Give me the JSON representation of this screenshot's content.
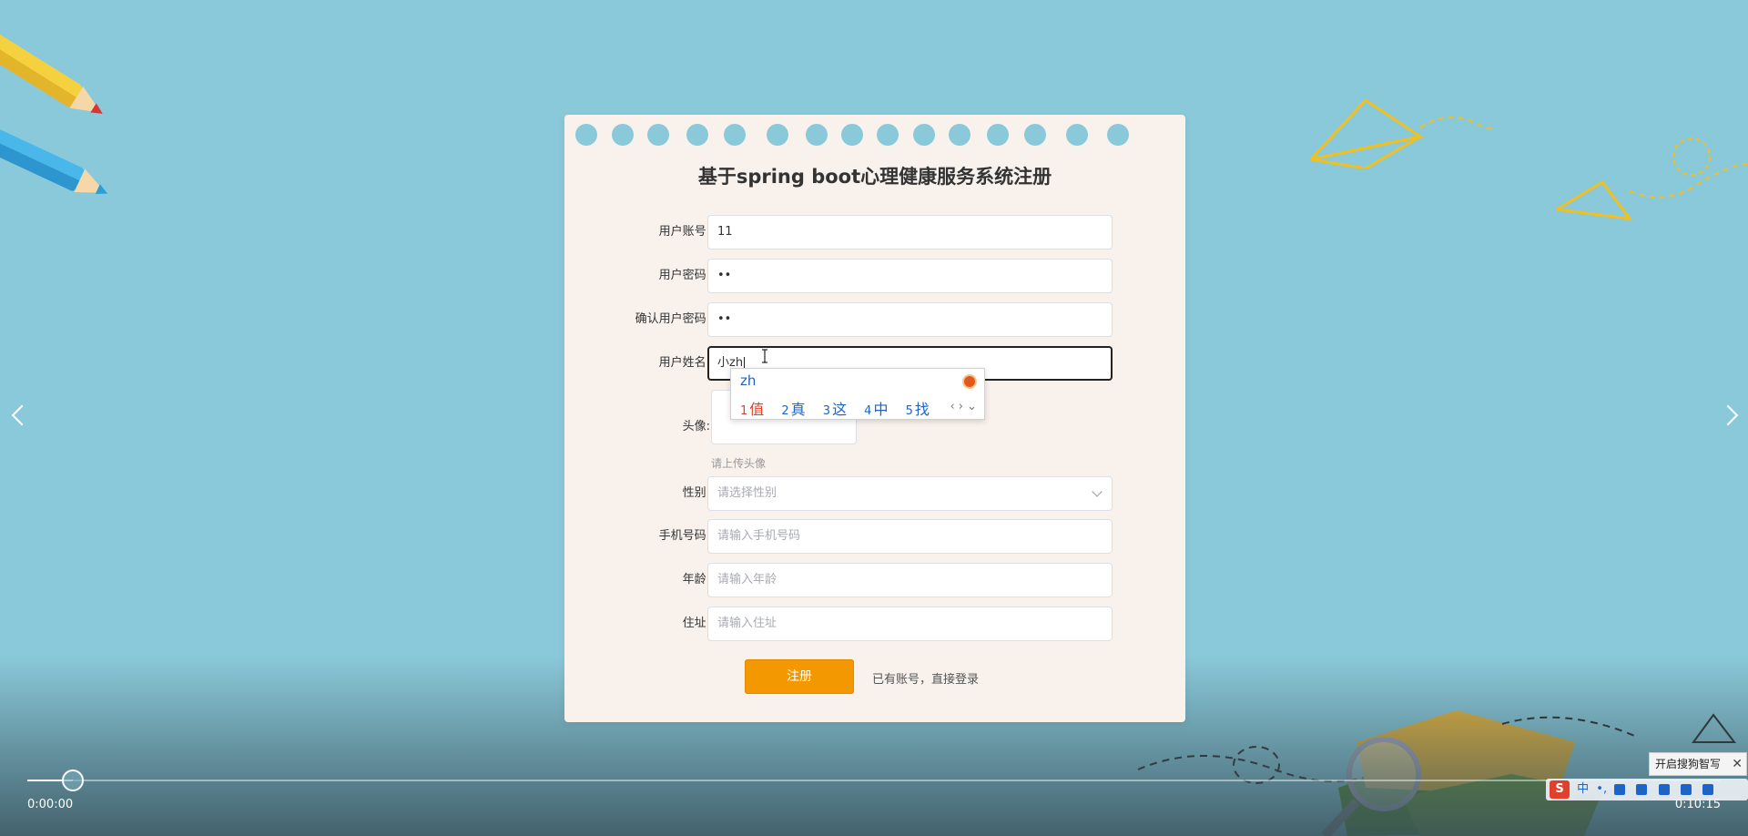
{
  "form": {
    "title": "基于spring boot心理健康服务系统注册",
    "fields": [
      {
        "label": "用户账号:",
        "value": "11",
        "placeholder": ""
      },
      {
        "label": "用户密码:",
        "value": "••",
        "placeholder": ""
      },
      {
        "label": "确认用户密码:",
        "value": "••",
        "placeholder": ""
      },
      {
        "label": "用户姓名:",
        "value": "小zh",
        "placeholder": ""
      }
    ],
    "avatar": {
      "label": "头像:",
      "hint": "请上传头像"
    },
    "gender": {
      "label": "性别:",
      "placeholder": "请选择性别"
    },
    "phone": {
      "label": "手机号码:",
      "placeholder": "请输入手机号码"
    },
    "age": {
      "label": "年龄:",
      "placeholder": "请输入年龄"
    },
    "address": {
      "label": "住址:",
      "placeholder": "请输入住址"
    },
    "register_label": "注册",
    "login_link": "已有账号，直接登录"
  },
  "ime": {
    "composition": "zh",
    "candidates": [
      {
        "num": "1",
        "text": "值"
      },
      {
        "num": "2",
        "text": "真"
      },
      {
        "num": "3",
        "text": "这"
      },
      {
        "num": "4",
        "text": "中"
      },
      {
        "num": "5",
        "text": "找"
      }
    ],
    "nav": "‹ › ⌄"
  },
  "player": {
    "current_time": "0:00:00",
    "total_time": "0:10:15",
    "progress": 0.027
  },
  "sogou": {
    "tooltip": "开启搜狗智写",
    "close": "✕",
    "logo": "S",
    "mode": "中",
    "punct": "•,"
  },
  "colors": {
    "background": "#8ac9d9",
    "card": "#f8f1ec",
    "accent": "#f39800",
    "ime_first": "#e0412c",
    "ime_blue": "#1e64c8"
  }
}
